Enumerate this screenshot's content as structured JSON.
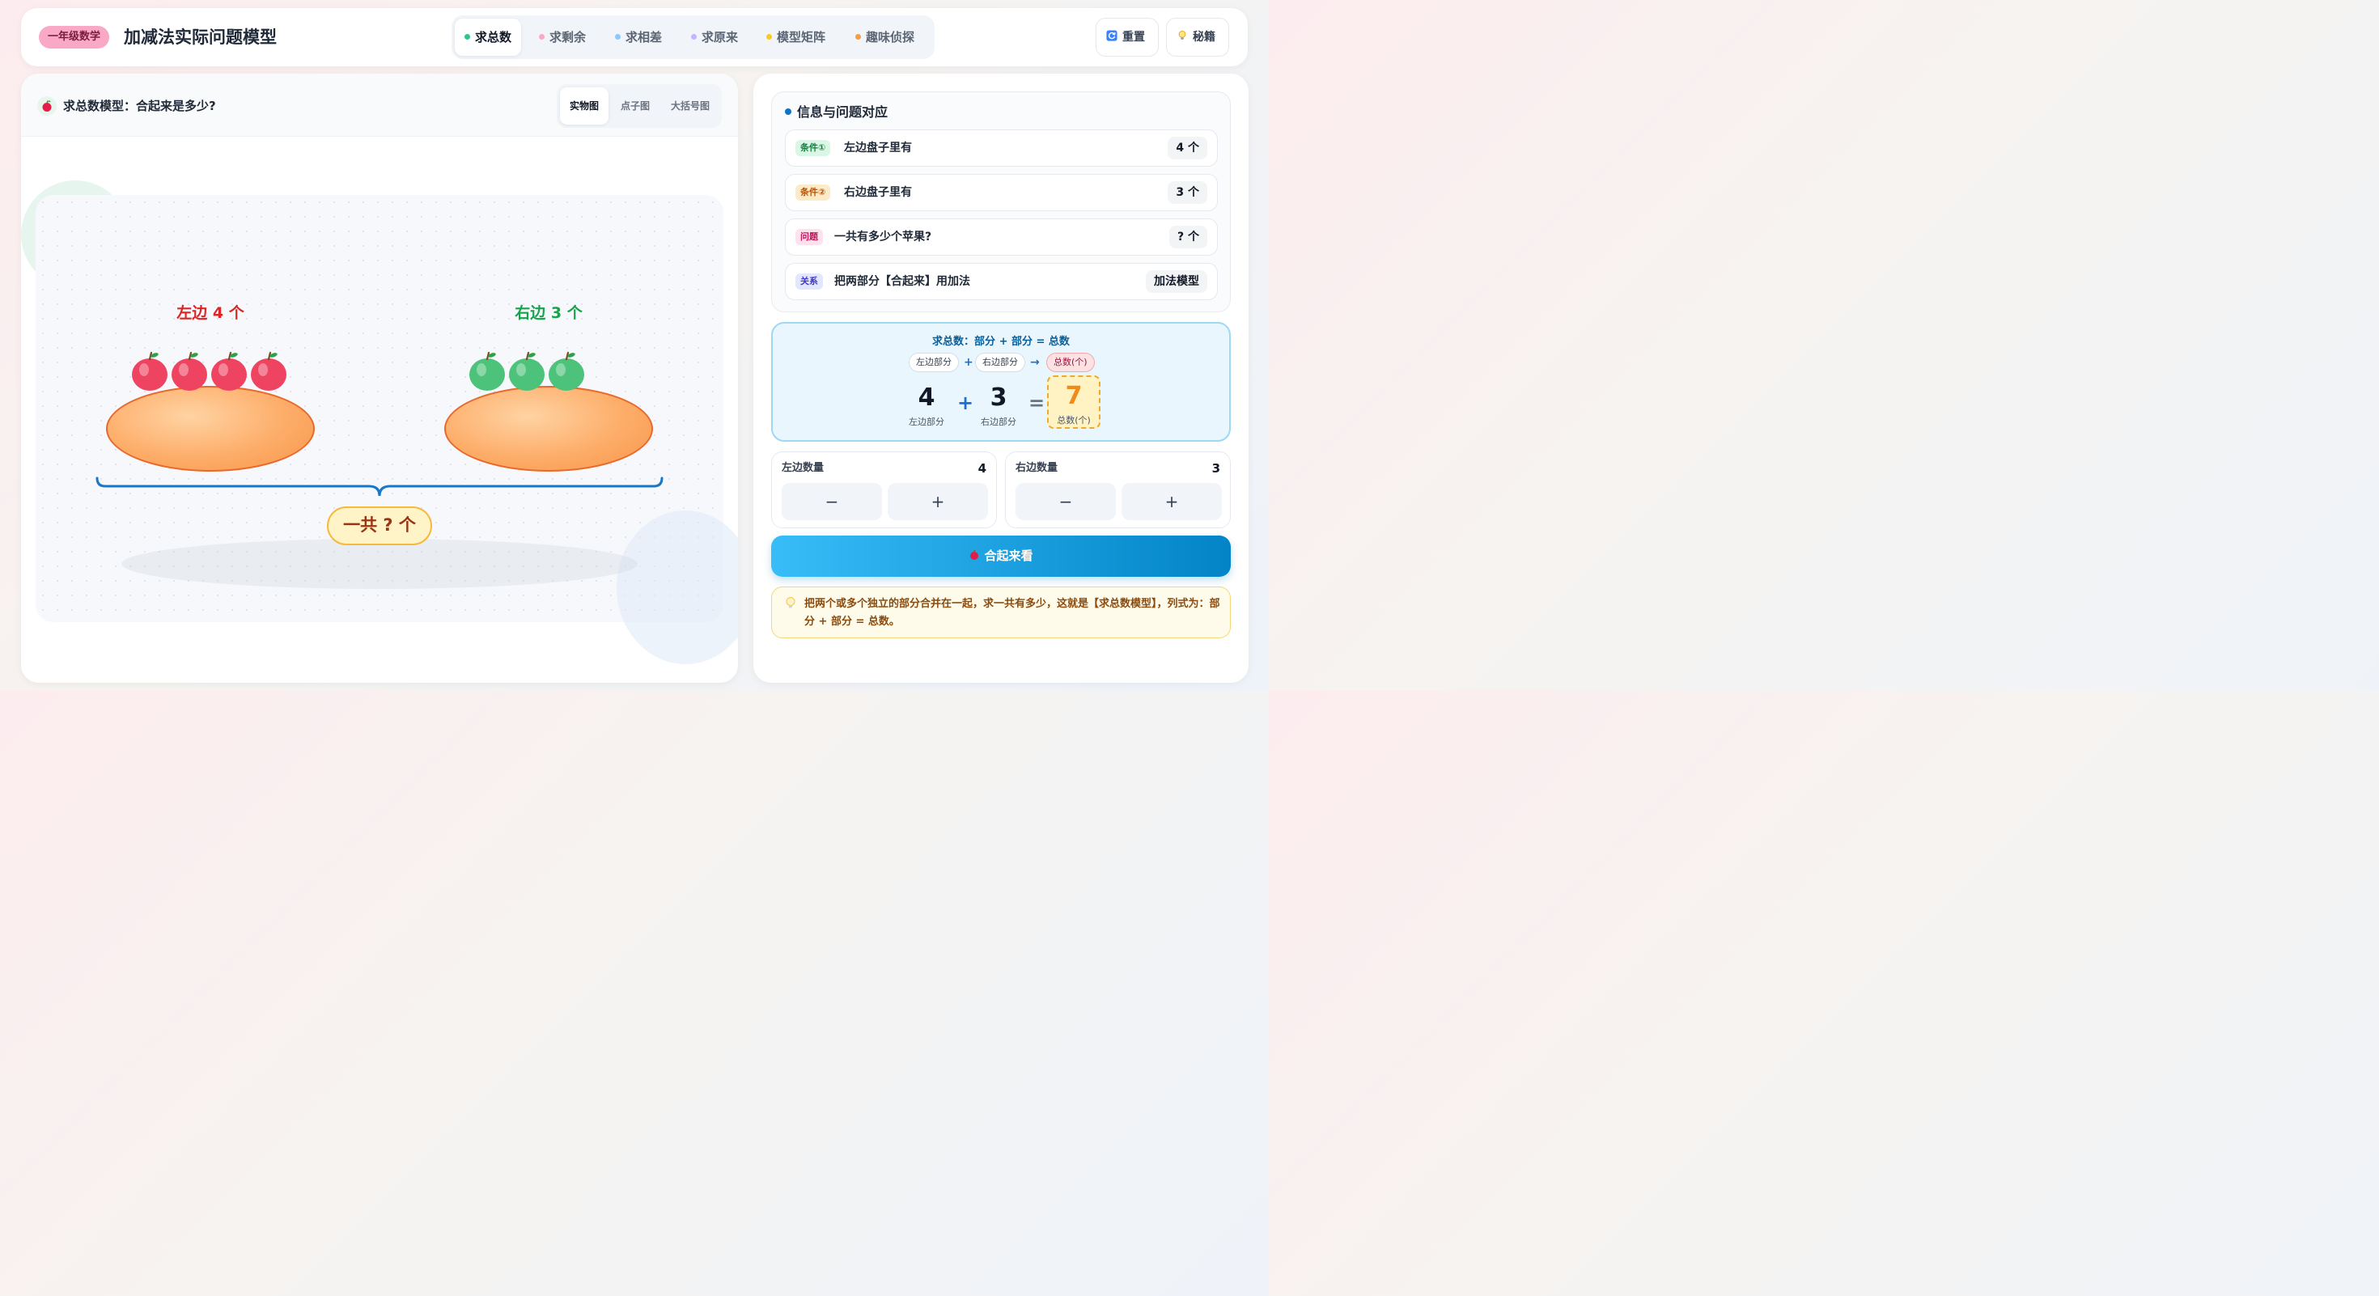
{
  "header": {
    "badge": "一年级数学",
    "title": "加减法实际问题模型",
    "tabs": [
      {
        "label": "求总数",
        "color": "#34c38f"
      },
      {
        "label": "求剩余",
        "color": "#f9a8c5"
      },
      {
        "label": "求相差",
        "color": "#93c5fd"
      },
      {
        "label": "求原来",
        "color": "#c4b5fd"
      },
      {
        "label": "模型矩阵",
        "color": "#facc15"
      },
      {
        "label": "趣味侦探",
        "color": "#f59e42"
      }
    ],
    "reset_label": "重置",
    "hint_label": "秘籍"
  },
  "scene": {
    "title": "求总数模型：合起来是多少?",
    "views": [
      "实物图",
      "点子图",
      "大括号图"
    ],
    "left_label": "左边 4 个",
    "right_label": "右边 3 个",
    "left_count": 4,
    "right_count": 3,
    "left_fruit_color": "#ef4461",
    "right_fruit_color": "#4cc27a",
    "total_label": "一共 ? 个"
  },
  "info": {
    "title": "信息与问题对应",
    "rows": [
      {
        "tag": "条件①",
        "text": "左边盘子里有",
        "value": "4 个"
      },
      {
        "tag": "条件②",
        "text": "右边盘子里有",
        "value": "3 个"
      },
      {
        "tag": "问题",
        "text": "一共有多少个苹果?",
        "value": "? 个"
      },
      {
        "tag": "关系",
        "text": "把两部分【合起来】用加法",
        "value": "加法模型"
      }
    ]
  },
  "model": {
    "title": "求总数：部分 + 部分 = 总数",
    "chip_left": "左边部分",
    "chip_plus": "+",
    "chip_right": "右边部分",
    "chip_arrow": "→",
    "chip_total": "总数(个)",
    "num_left": "4",
    "op_plus": "+",
    "num_right": "3",
    "op_eq": "=",
    "num_total": "7",
    "cap_left": "左边部分",
    "cap_right": "右边部分",
    "cap_total": "总数(个)"
  },
  "counters": {
    "left_label": "左边数量",
    "left_value": "4",
    "right_label": "右边数量",
    "right_value": "3",
    "minus": "−",
    "plus": "+"
  },
  "combine_label": "合起来看",
  "tip": "把两个或多个独立的部分合并在一起，求一共有多少，这就是【求总数模型】，列式为：部分 + 部分 = 总数。"
}
